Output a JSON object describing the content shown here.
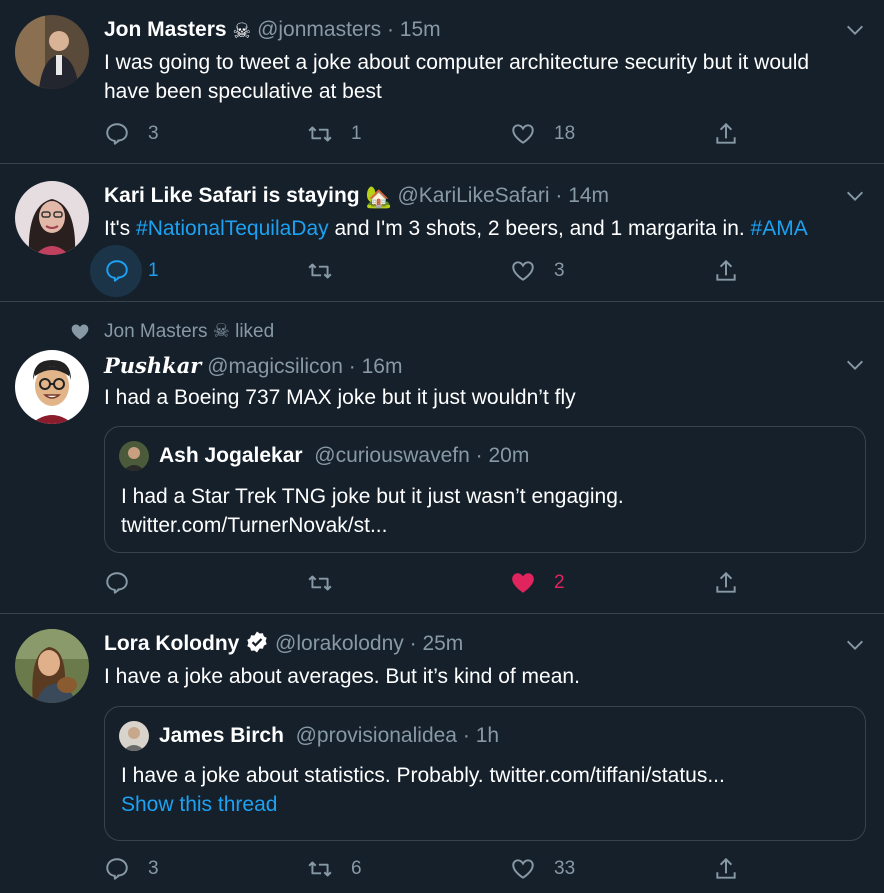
{
  "tweets": [
    {
      "name": "Jon Masters",
      "name_emoji": "☠",
      "handle": "@jonmasters",
      "time": "15m",
      "text": "I was going to tweet a joke about computer architecture security but it would have been speculative at best",
      "replies": "3",
      "retweets": "1",
      "likes": "18"
    },
    {
      "name": "Kari Like Safari is staying",
      "name_emoji": "🏡",
      "handle": "@KariLikeSafari",
      "time": "14m",
      "text_before": "It's ",
      "hashtag1": "#NationalTequilaDay",
      "text_middle": " and I'm 3 shots, 2 beers, and 1 margarita in. ",
      "hashtag2": "#AMA",
      "replies": "1",
      "retweets": "",
      "likes": "3"
    },
    {
      "social_context_name": "Jon Masters",
      "social_context_emoji": "☠",
      "social_context_action": "liked",
      "name": "𝑷𝒖𝒔𝒉𝒌𝒂𝒓",
      "handle": "@magicsilicon",
      "time": "16m",
      "text": "I had a Boeing 737 MAX joke but it just wouldn’t fly",
      "quote": {
        "name": "Ash Jogalekar",
        "handle": "@curiouswavefn",
        "time": "20m",
        "text_line1": "I had a Star Trek TNG joke but it just wasn’t engaging.",
        "text_line2": "twitter.com/TurnerNovak/st..."
      },
      "replies": "",
      "retweets": "",
      "likes": "2",
      "like_color": "#e0245e"
    },
    {
      "name": "Lora Kolodny",
      "handle": "@lorakolodny",
      "time": "25m",
      "text": "I have a joke about averages. But it’s kind of mean.",
      "quote": {
        "name": "James Birch",
        "handle": "@provisionalidea",
        "time": "1h",
        "text_line1": "I have a joke about statistics. Probably. twitter.com/tiffani/status...",
        "show_thread": "Show this thread"
      },
      "replies": "3",
      "retweets": "6",
      "likes": "33"
    }
  ],
  "separator": "·",
  "colors": {
    "background": "#15202b",
    "link": "#1da1f2",
    "muted": "#8899a6",
    "like_active": "#e0245e",
    "border": "#38444d"
  },
  "icons": [
    "reply-icon",
    "retweet-icon",
    "like-icon",
    "share-icon",
    "chevron-down-icon",
    "verified-icon",
    "heart-liked-icon"
  ]
}
